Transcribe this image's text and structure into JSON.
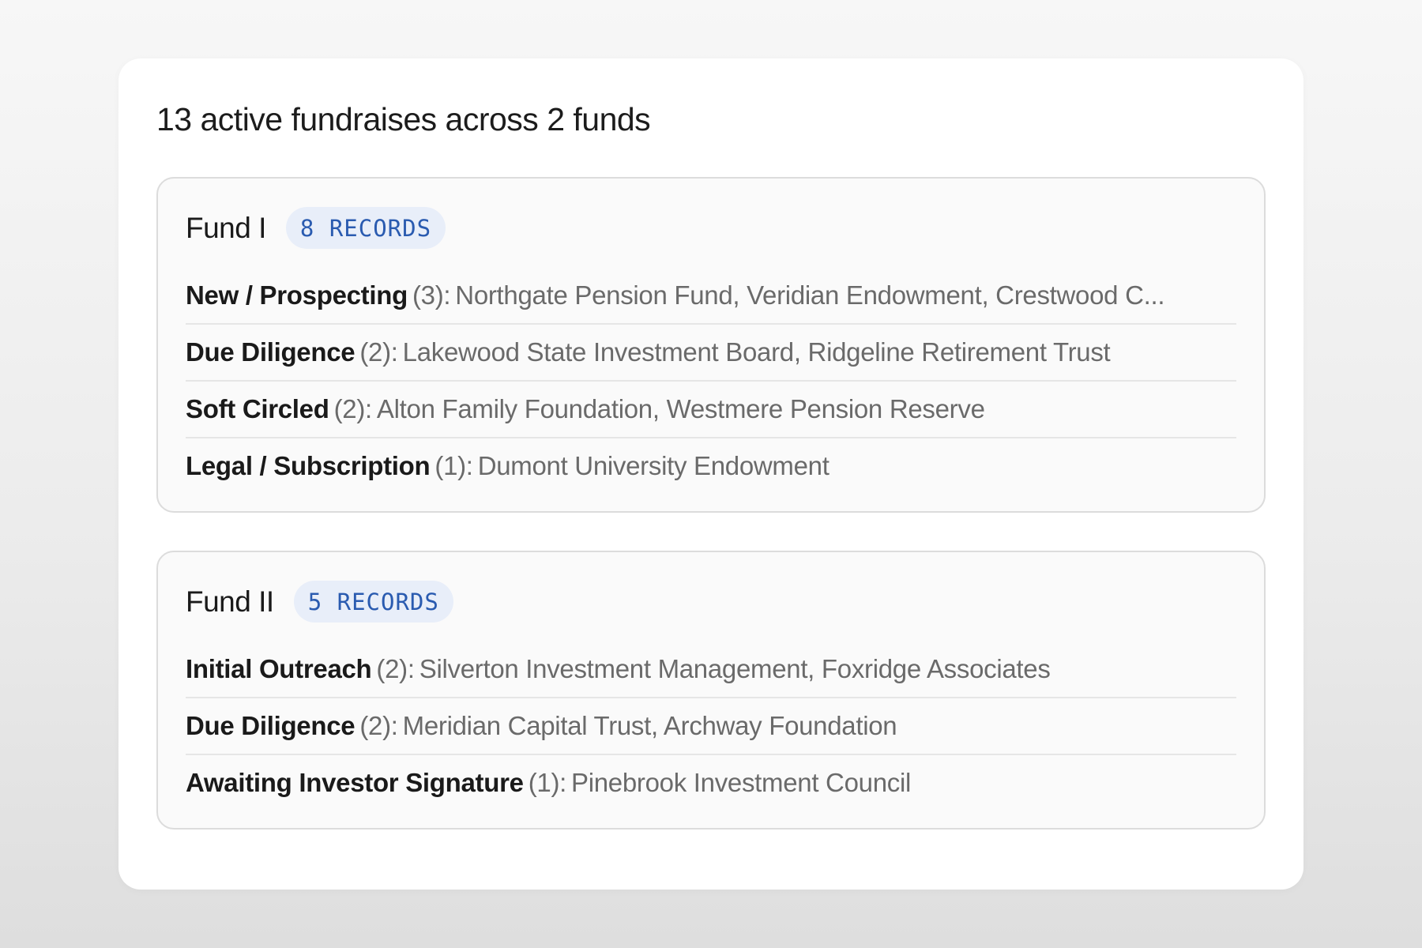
{
  "summary": "13 active fundraises across 2 funds",
  "funds": [
    {
      "name": "Fund I",
      "badge": "8 RECORDS",
      "stages": [
        {
          "stage": "New / Prospecting",
          "count": "(3):",
          "names": "Northgate Pension Fund, Veridian Endowment, Crestwood C..."
        },
        {
          "stage": "Due Diligence",
          "count": "(2):",
          "names": "Lakewood State Investment Board, Ridgeline Retirement Trust"
        },
        {
          "stage": "Soft Circled",
          "count": "(2):",
          "names": "Alton Family Foundation, Westmere Pension Reserve"
        },
        {
          "stage": "Legal / Subscription",
          "count": "(1):",
          "names": "Dumont University Endowment"
        }
      ]
    },
    {
      "name": "Fund II",
      "badge": "5 RECORDS",
      "stages": [
        {
          "stage": "Initial Outreach",
          "count": "(2):",
          "names": "Silverton Investment Management, Foxridge Associates"
        },
        {
          "stage": "Due Diligence",
          "count": "(2):",
          "names": "Meridian Capital Trust, Archway Foundation"
        },
        {
          "stage": "Awaiting Investor Signature",
          "count": "(1):",
          "names": "Pinebrook Investment Council"
        }
      ]
    }
  ]
}
